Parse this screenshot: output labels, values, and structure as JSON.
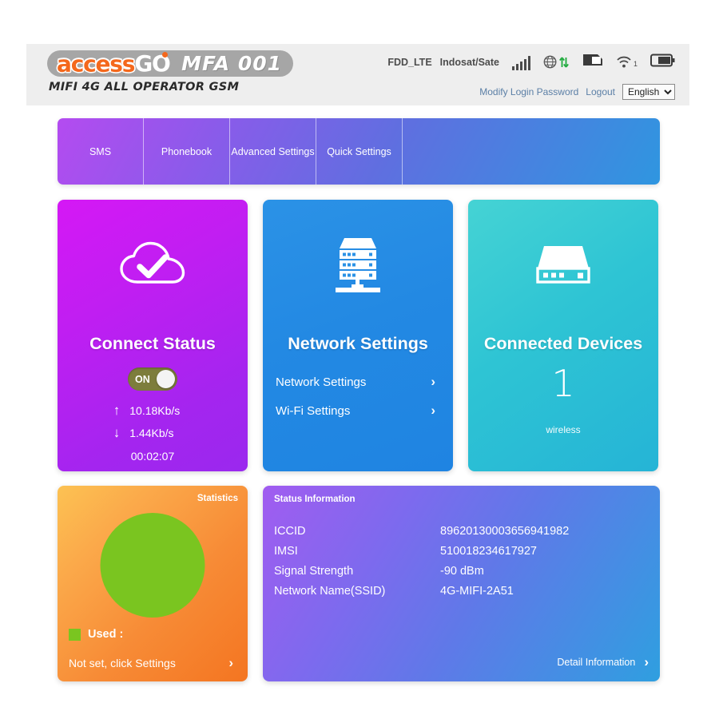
{
  "brand": {
    "logo_access": "access",
    "logo_go": "GO",
    "model": "MFA 001",
    "subtitle": "MIFI 4G ALL OPERATOR GSM"
  },
  "header": {
    "network_type": "FDD_LTE",
    "carrier": "Indosat/Sate",
    "wifi_clients": "1",
    "links": {
      "modify_password": "Modify Login Password",
      "logout": "Logout"
    },
    "language": {
      "selected": "English",
      "options": [
        "English"
      ]
    },
    "icons": [
      "signal-bars-icon",
      "globe-data-icon",
      "sim-card-icon",
      "wifi-icon",
      "battery-icon"
    ]
  },
  "tabs": [
    {
      "label": "SMS"
    },
    {
      "label": "Phonebook"
    },
    {
      "label": "Advanced Settings"
    },
    {
      "label": "Quick Settings"
    }
  ],
  "connect_status": {
    "title": "Connect Status",
    "icon": "cloud-check-icon",
    "toggle_label": "ON",
    "toggle_state": "on",
    "upload": "10.18Kb/s",
    "download": "1.44Kb/s",
    "upload_arrow": "↑",
    "download_arrow": "↓",
    "uptime": "00:02:07"
  },
  "network_settings": {
    "title": "Network Settings",
    "icon": "server-rack-icon",
    "links": [
      {
        "label": "Network Settings",
        "chevron": "›"
      },
      {
        "label": "Wi-Fi Settings",
        "chevron": "›"
      }
    ]
  },
  "connected_devices": {
    "title": "Connected Devices",
    "icon": "router-device-icon",
    "count": "1",
    "sublabel": "wireless"
  },
  "statistics": {
    "label": "Statistics",
    "legend_label": "Used :",
    "legend_color": "#7ac520",
    "footer_text": "Not set, click Settings",
    "footer_chevron": "›"
  },
  "status_information": {
    "title": "Status Information",
    "rows": [
      {
        "key": "ICCID",
        "value": "89620130003656941982"
      },
      {
        "key": "IMSI",
        "value": "510018234617927"
      },
      {
        "key": "Signal Strength",
        "value": "-90 dBm"
      },
      {
        "key": "Network Name(SSID)",
        "value": "4G-MIFI-2A51"
      }
    ],
    "detail_link": "Detail Information",
    "detail_chevron": "›"
  },
  "chart_data": {
    "type": "pie",
    "title": "Statistics",
    "categories": [
      "Used"
    ],
    "values": [
      100
    ],
    "colors": [
      "#7ac520"
    ],
    "note": "Not set, click Settings"
  }
}
